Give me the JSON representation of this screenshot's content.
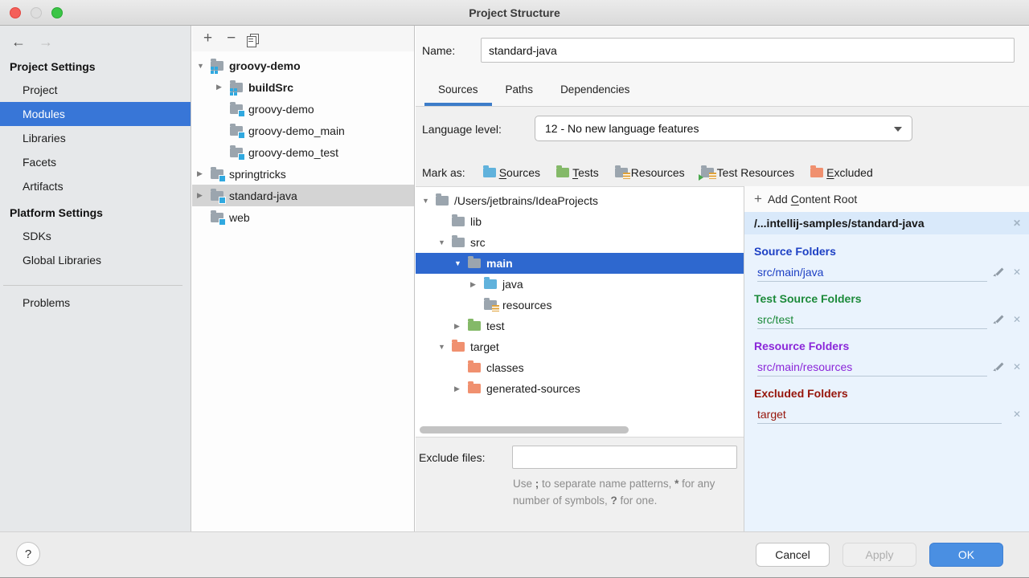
{
  "window": {
    "title": "Project Structure"
  },
  "colors": {
    "accent_selection": "#3876d7",
    "tree_selection": "#2e68cf",
    "tab_underline": "#3d7dc9",
    "content_pane_bg": "#eaf3fd",
    "content_pane_header_bg": "#d9e9fa",
    "folder_gray": "#9ba5ae",
    "folder_source_blue": "#60b2dc",
    "folder_test_green": "#84b968",
    "folder_excluded_orange": "#f0906f",
    "resource_stripe_yellow": "#e0a23a",
    "module_badge_blue": "#30a9e0"
  },
  "sidebar": {
    "back_icon": "back-arrow",
    "forward_icon": "forward-arrow",
    "sections": [
      {
        "header": "Project Settings",
        "items": [
          "Project",
          "Modules",
          "Libraries",
          "Facets",
          "Artifacts"
        ]
      },
      {
        "header": "Platform Settings",
        "items": [
          "SDKs",
          "Global Libraries"
        ]
      }
    ],
    "selected": "Modules",
    "extra_item": "Problems"
  },
  "module_panel": {
    "toolbar": {
      "add": "+",
      "remove": "−",
      "copy": "copy-icon"
    },
    "tree": [
      {
        "label": "groovy-demo",
        "level": 0,
        "arrow": "down",
        "icon": "module-group",
        "bold": true
      },
      {
        "label": "buildSrc",
        "level": 1,
        "arrow": "right",
        "icon": "module-group",
        "bold": true
      },
      {
        "label": "groovy-demo",
        "level": 1,
        "icon": "module"
      },
      {
        "label": "groovy-demo_main",
        "level": 1,
        "icon": "module"
      },
      {
        "label": "groovy-demo_test",
        "level": 1,
        "icon": "module"
      },
      {
        "label": "springtricks",
        "level": 0,
        "arrow": "right",
        "icon": "module"
      },
      {
        "label": "standard-java",
        "level": 0,
        "arrow": "right",
        "icon": "module",
        "selected": true
      },
      {
        "label": "web",
        "level": 0,
        "icon": "module"
      }
    ]
  },
  "editor": {
    "name_label": "Name:",
    "name_value": "standard-java",
    "tabs": [
      {
        "label": "Sources",
        "selected": true
      },
      {
        "label": "Paths",
        "selected": false
      },
      {
        "label": "Dependencies",
        "selected": false
      }
    ],
    "language_level_label": "Language level:",
    "language_level_value": "12 - No new language features",
    "mark_as_label": "Mark as:",
    "mark_as": [
      {
        "label": "Sources",
        "mnemonic": "S",
        "icon": "folder-source"
      },
      {
        "label": "Tests",
        "mnemonic": "T",
        "icon": "folder-test"
      },
      {
        "label": "Resources",
        "mnemonic": "",
        "icon": "folder-resource"
      },
      {
        "label": "Test Resources",
        "mnemonic": "",
        "icon": "folder-test-resource"
      },
      {
        "label": "Excluded",
        "mnemonic": "E",
        "icon": "folder-excluded"
      }
    ],
    "file_tree": [
      {
        "label": "/Users/jetbrains/IdeaProjects",
        "level": 0,
        "arrow": "down",
        "icon": "folder"
      },
      {
        "label": "lib",
        "level": 1,
        "icon": "folder"
      },
      {
        "label": "src",
        "level": 1,
        "arrow": "down",
        "icon": "folder"
      },
      {
        "label": "main",
        "level": 2,
        "arrow": "down",
        "icon": "folder",
        "selected": true
      },
      {
        "label": "java",
        "level": 3,
        "arrow": "right",
        "icon": "folder-source"
      },
      {
        "label": "resources",
        "level": 3,
        "icon": "folder-resource"
      },
      {
        "label": "test",
        "level": 2,
        "arrow": "right",
        "icon": "folder-test"
      },
      {
        "label": "target",
        "level": 1,
        "arrow": "down",
        "icon": "folder-excluded"
      },
      {
        "label": "classes",
        "level": 2,
        "icon": "folder-excluded"
      },
      {
        "label": "generated-sources",
        "level": 2,
        "arrow": "right",
        "icon": "folder-excluded"
      }
    ],
    "exclude_label": "Exclude files:",
    "exclude_value": "",
    "exclude_hint": [
      {
        "t": "Use "
      },
      {
        "t": ";",
        "b": true
      },
      {
        "t": " to separate name patterns, "
      },
      {
        "t": "*",
        "b": true
      },
      {
        "t": " for any number of symbols, "
      },
      {
        "t": "?",
        "b": true
      },
      {
        "t": " for one."
      }
    ]
  },
  "content_pane": {
    "add_label": "Add Content Root",
    "add_mnemonic": "C",
    "root_path": "/...intellij-samples/standard-java",
    "groups": [
      {
        "title": "Source Folders",
        "color": "#1d40c4",
        "items": [
          {
            "path": "src/main/java",
            "editable": true
          }
        ]
      },
      {
        "title": "Test Source Folders",
        "color": "#1c8a3a",
        "items": [
          {
            "path": "src/test",
            "editable": true
          }
        ]
      },
      {
        "title": "Resource Folders",
        "color": "#8b26d9",
        "items": [
          {
            "path": "src/main/resources",
            "editable": true
          }
        ]
      },
      {
        "title": "Excluded Folders",
        "color": "#96150a",
        "items": [
          {
            "path": "target",
            "editable": false
          }
        ]
      }
    ]
  },
  "footer": {
    "help_label": "?",
    "cancel_label": "Cancel",
    "apply_label": "Apply",
    "ok_label": "OK"
  }
}
